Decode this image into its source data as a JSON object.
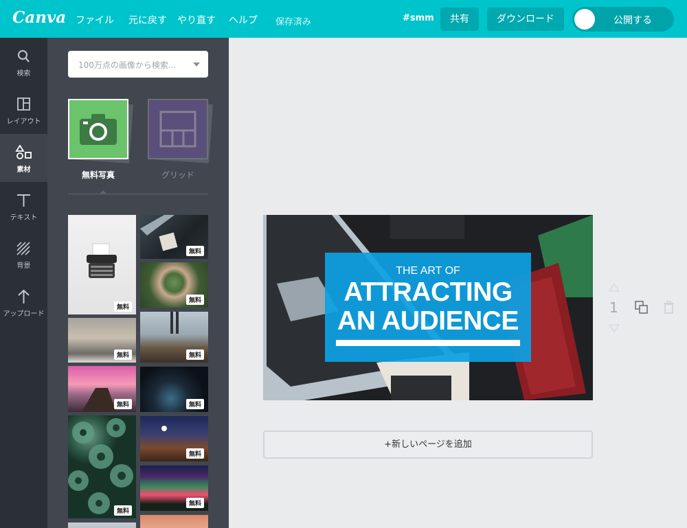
{
  "app": {
    "logo": "Canva"
  },
  "menu": {
    "file": "ファイル",
    "undo": "元に戻す",
    "redo": "やり直す",
    "help": "ヘルプ",
    "saved": "保存済み"
  },
  "header": {
    "tag": "#smm",
    "share": "共有",
    "download": "ダウンロード",
    "publish": "公開する"
  },
  "rail": {
    "search": "検索",
    "layout": "レイアウト",
    "elements": "素材",
    "text": "テキスト",
    "background": "背景",
    "upload": "アップロード"
  },
  "panel": {
    "search_placeholder": "100万点の画像から検索...",
    "categories": {
      "free_photos": "無料写真",
      "grid": "グリッド"
    },
    "badge": "無料"
  },
  "design": {
    "line1": "THE ART OF",
    "line2": "ATTRACTING",
    "line3": "AN AUDIENCE"
  },
  "page": {
    "number": "1",
    "add_page": "+新しいページを追加"
  },
  "colors": {
    "brand": "#00c4cc",
    "panel": "#41464f",
    "rail": "#2b2f36",
    "title_box": "#0da0e2"
  }
}
